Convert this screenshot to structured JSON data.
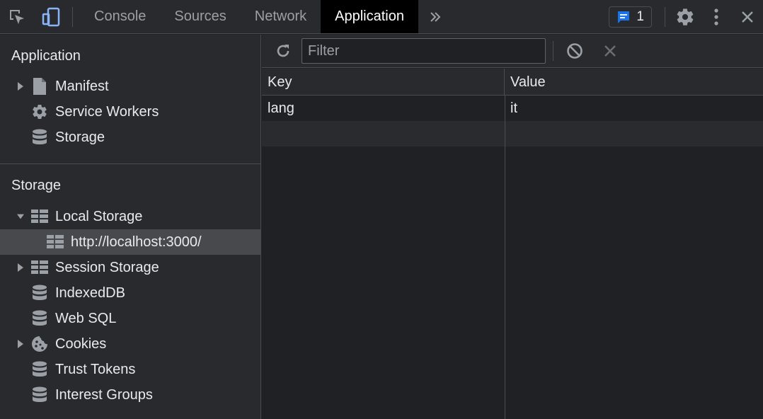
{
  "toolbar_tabs": [
    {
      "label": "Console"
    },
    {
      "label": "Sources"
    },
    {
      "label": "Network"
    },
    {
      "label": "Application"
    }
  ],
  "issues_count": "1",
  "sidebar": {
    "application_section": {
      "title": "Application",
      "items": [
        {
          "label": "Manifest",
          "icon": "file-icon"
        },
        {
          "label": "Service Workers",
          "icon": "gear-icon"
        },
        {
          "label": "Storage",
          "icon": "database-icon"
        }
      ]
    },
    "storage_section": {
      "title": "Storage",
      "items": [
        {
          "label": "Local Storage",
          "icon": "table-icon"
        },
        {
          "label": "http://localhost:3000/",
          "icon": "table-icon"
        },
        {
          "label": "Session Storage",
          "icon": "table-icon"
        },
        {
          "label": "IndexedDB",
          "icon": "database-icon"
        },
        {
          "label": "Web SQL",
          "icon": "database-icon"
        },
        {
          "label": "Cookies",
          "icon": "cookie-icon"
        },
        {
          "label": "Trust Tokens",
          "icon": "database-icon"
        },
        {
          "label": "Interest Groups",
          "icon": "database-icon"
        }
      ]
    }
  },
  "main": {
    "filter_placeholder": "Filter",
    "columns": {
      "key": "Key",
      "value": "Value"
    },
    "rows": [
      {
        "key": "lang",
        "value": "it"
      }
    ]
  },
  "colors": {
    "background": "#202124",
    "panel": "#292a2d",
    "border": "#494c50",
    "selected": "#48494c",
    "accent": "#8ab4f8"
  }
}
